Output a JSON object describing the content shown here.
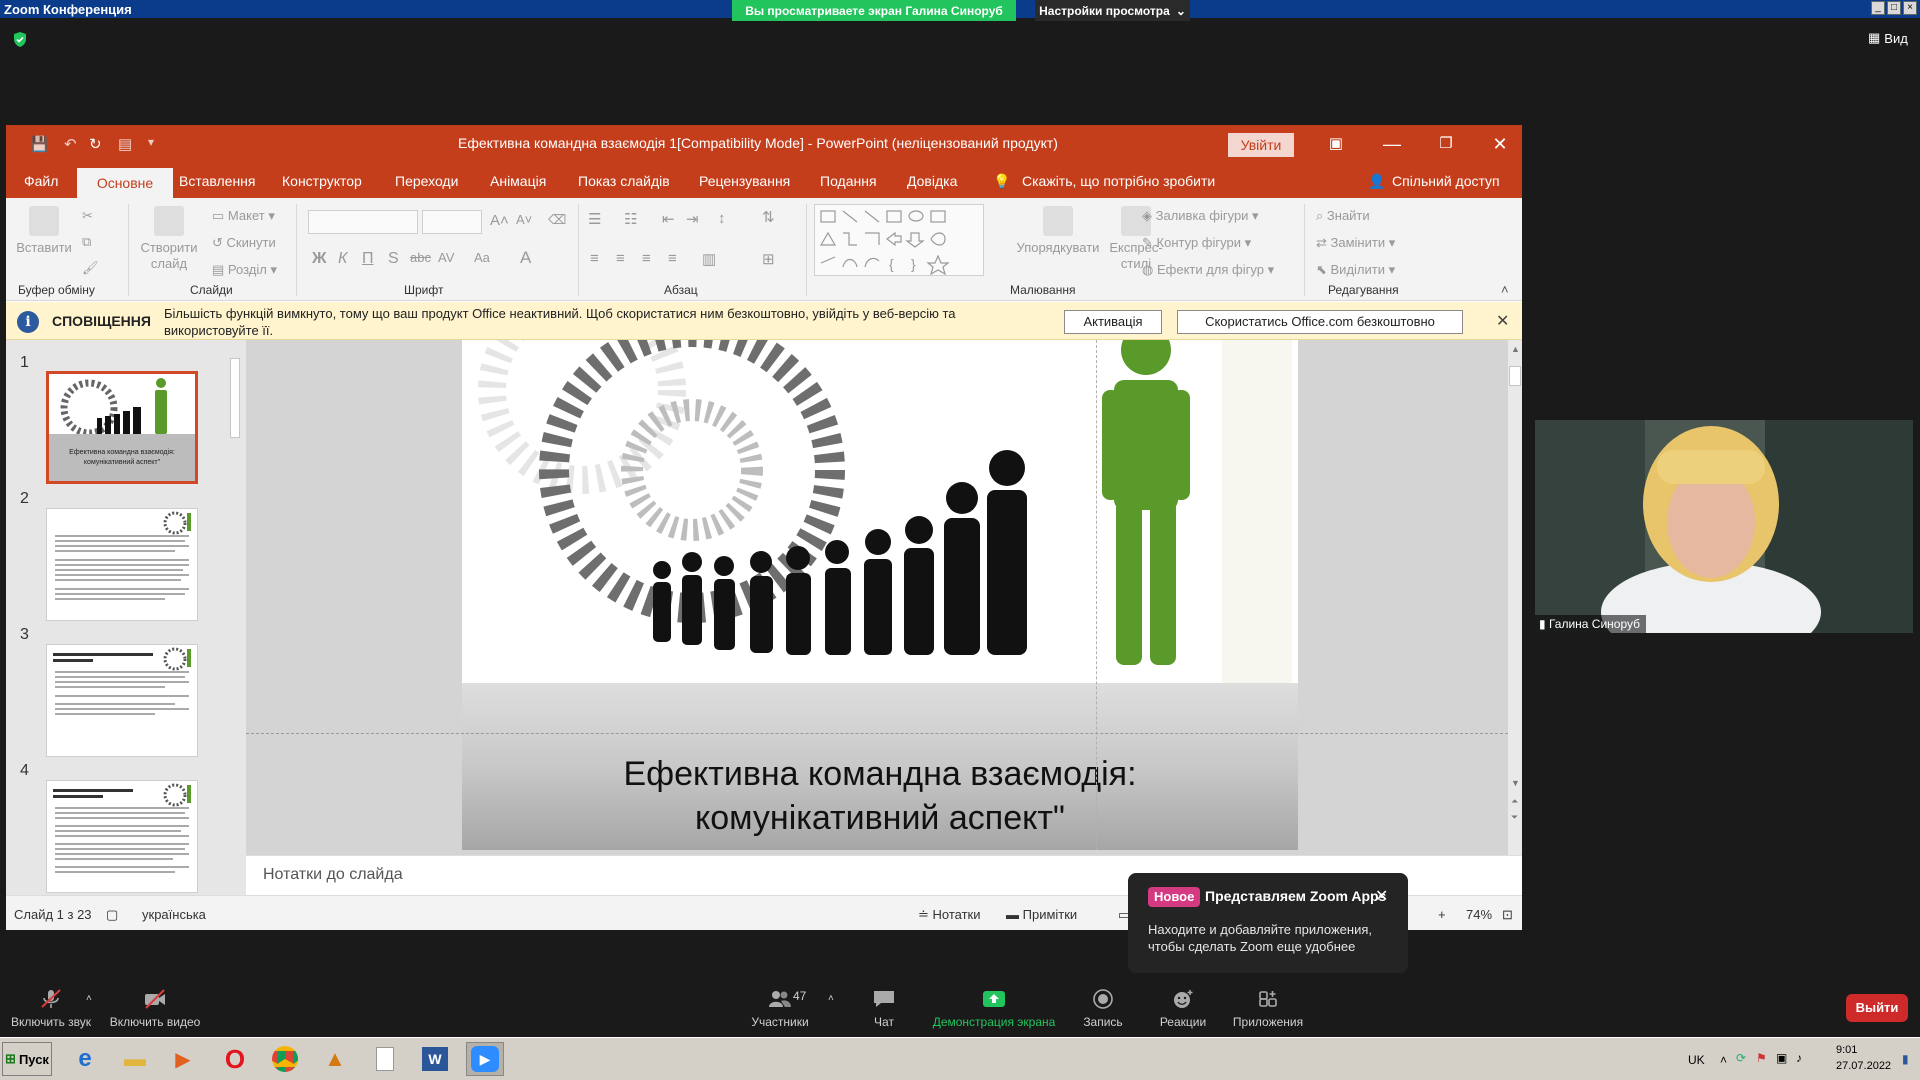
{
  "zoom": {
    "window_title": "Zoom Конференция",
    "share_banner": "Вы просматриваете экран Галина Синоруб",
    "view_options": "Настройки просмотра",
    "view_button": "Вид",
    "toolbar": {
      "mute": "Включить звук",
      "video": "Включить видео",
      "participants": "Участники",
      "participants_count": "47",
      "chat": "Чат",
      "share": "Демонстрация экрана",
      "record": "Запись",
      "reactions": "Реакции",
      "apps": "Приложения",
      "leave": "Выйти"
    },
    "video_name": "Галина Синоруб",
    "apps_popup": {
      "badge": "Новое",
      "title": "Представляем Zoom Apps",
      "body": "Находите и добавляйте приложения, чтобы сделать Zoom еще удобнее"
    }
  },
  "ppt": {
    "title": "Ефективна командна взаємодія 1[Compatibility Mode]  -  PowerPoint (неліцензований продукт)",
    "signin": "Увійти",
    "tabs": [
      "Файл",
      "Основне",
      "Вставлення",
      "Конструктор",
      "Переходи",
      "Анімація",
      "Показ слайдів",
      "Рецензування",
      "Подання",
      "Довідка"
    ],
    "tell_me": "Скажіть, що потрібно зробити",
    "share": "Спільний доступ",
    "ribbon": {
      "paste": "Вставити",
      "clipboard": "Буфер обміну",
      "new_slide_1": "Створити",
      "new_slide_2": "слайд",
      "layout": "Макет",
      "reset": "Скинути",
      "section": "Розділ",
      "slides": "Слайди",
      "font": "Шрифт",
      "paragraph": "Абзац",
      "arrange": "Упорядкувати",
      "quick_styles_1": "Експрес-",
      "quick_styles_2": "стилі",
      "shape_fill": "Заливка фігури",
      "shape_outline": "Контур фігури",
      "shape_effects": "Ефекти для фігур",
      "drawing": "Малювання",
      "find": "Знайти",
      "replace": "Замінити",
      "select": "Виділити",
      "editing": "Редагування"
    },
    "notification": {
      "title": "СПОВІЩЕННЯ",
      "message": "Більшість функцій вимкнуто, тому що ваш продукт Office неактивний. Щоб скористатися ним безкоштовно, увійдіть у веб-версію та використовуйте її.",
      "activate": "Активація",
      "use_online": "Скористатись Office.com безкоштовно"
    },
    "thumb_numbers": [
      "1",
      "2",
      "3",
      "4"
    ],
    "slide_title_line1": "Ефективна командна взаємодія:",
    "slide_title_line2": "комунікативний аспект\"",
    "notes_placeholder": "Нотатки до слайда",
    "status": {
      "slide": "Слайд 1 з 23",
      "language": "українська",
      "notes": "Нотатки",
      "comments": "Примітки",
      "zoom": "74%"
    }
  },
  "taskbar": {
    "start": "Пуск",
    "lang": "UK",
    "time": "9:01",
    "date": "27.07.2022"
  },
  "colors": {
    "ppt_accent": "#c43e1c",
    "zoom_green": "#22c45e",
    "leave_red": "#cf2a2a",
    "figure_green": "#5a9a2a"
  }
}
